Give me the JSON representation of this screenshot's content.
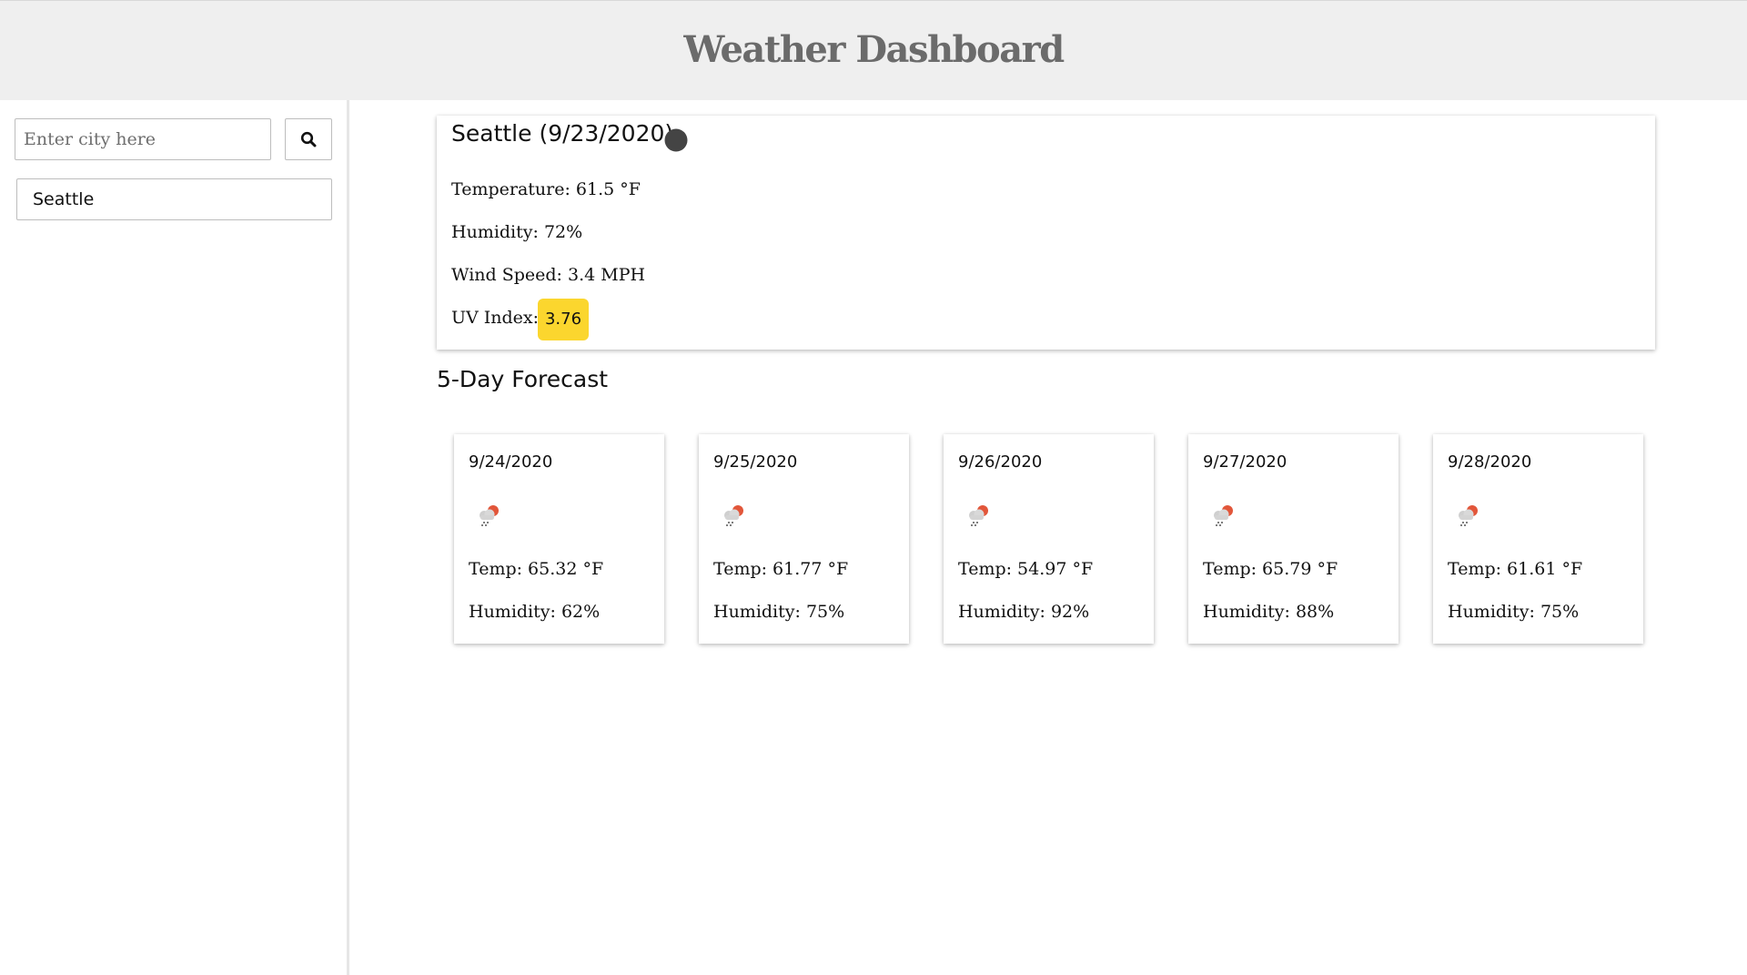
{
  "header": {
    "title": "Weather Dashboard"
  },
  "search": {
    "placeholder": "Enter city here",
    "value": "",
    "button_icon": "search-icon"
  },
  "history": [
    {
      "label": "Seattle"
    }
  ],
  "current": {
    "title": "Seattle (9/23/2020)",
    "icon": "weather-icon",
    "temperature": "Temperature: 61.5 °F",
    "humidity": "Humidity: 72%",
    "wind": "Wind Speed: 3.4 MPH",
    "uv_label": "UV Index:",
    "uv_value": "3.76",
    "uv_color": "#fbd62e"
  },
  "forecast": {
    "title": "5-Day Forecast",
    "days": [
      {
        "date": "9/24/2020",
        "icon": "rain-cloud-icon",
        "temp": "Temp: 65.32 °F",
        "humidity": "Humidity: 62%"
      },
      {
        "date": "9/25/2020",
        "icon": "rain-cloud-icon",
        "temp": "Temp: 61.77 °F",
        "humidity": "Humidity: 75%"
      },
      {
        "date": "9/26/2020",
        "icon": "rain-cloud-icon",
        "temp": "Temp: 54.97 °F",
        "humidity": "Humidity: 92%"
      },
      {
        "date": "9/27/2020",
        "icon": "rain-cloud-icon",
        "temp": "Temp: 65.79 °F",
        "humidity": "Humidity: 88%"
      },
      {
        "date": "9/28/2020",
        "icon": "rain-cloud-icon",
        "temp": "Temp: 61.61 °F",
        "humidity": "Humidity: 75%"
      }
    ]
  }
}
